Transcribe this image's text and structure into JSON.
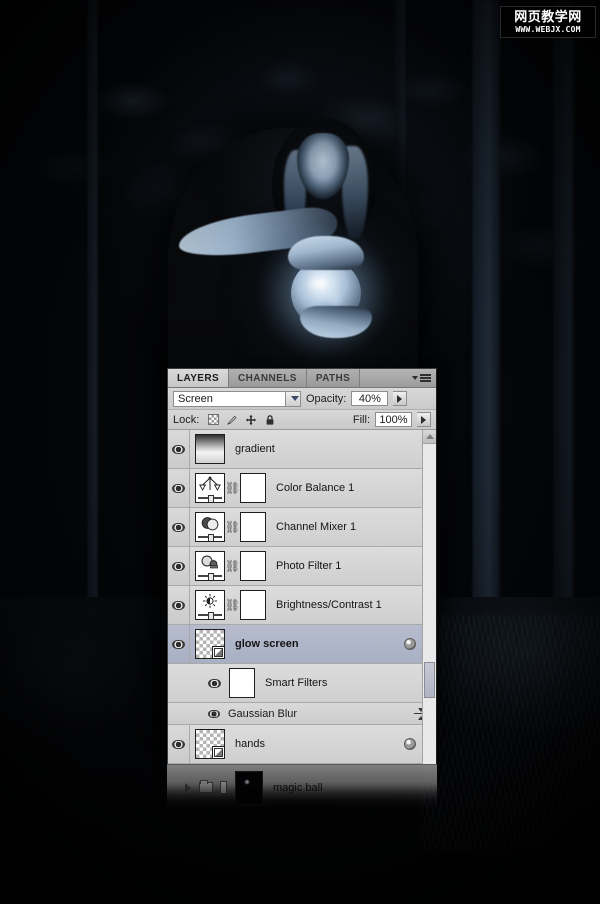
{
  "watermark": {
    "chinese": "网页教学网",
    "url": "WWW.WEBJX.COM"
  },
  "photo": {
    "description": "dark-forest-hooded-figure-with-glowing-magic-ball"
  },
  "panel": {
    "tabs": [
      {
        "label": "LAYERS",
        "active": true
      },
      {
        "label": "CHANNELS",
        "active": false
      },
      {
        "label": "PATHS",
        "active": false
      }
    ],
    "menu_icon": "panel-menu-icon",
    "blend": {
      "mode_value": "Screen",
      "opacity_label": "Opacity:",
      "opacity_value": "40%",
      "fill_label": "Fill:",
      "fill_value": "100%"
    },
    "lock": {
      "label": "Lock:",
      "items": [
        {
          "icon": "lock-transparent-pixels-icon"
        },
        {
          "icon": "lock-image-pixels-brush-icon"
        },
        {
          "icon": "lock-position-move-icon"
        },
        {
          "icon": "lock-all-padlock-icon"
        }
      ]
    },
    "layers": [
      {
        "name": "gradient",
        "visible": true,
        "selected": false,
        "thumb": "gradient-thumbnail",
        "kind": "pixel",
        "has_mask": false,
        "bold": false
      },
      {
        "name": "Color Balance 1",
        "visible": true,
        "selected": false,
        "thumb": "color-balance-adjustment-icon",
        "kind": "adjustment",
        "has_mask": true,
        "bold": false
      },
      {
        "name": "Channel Mixer 1",
        "visible": true,
        "selected": false,
        "thumb": "channel-mixer-adjustment-icon",
        "kind": "adjustment",
        "has_mask": true,
        "bold": false
      },
      {
        "name": "Photo Filter 1",
        "visible": true,
        "selected": false,
        "thumb": "photo-filter-adjustment-icon",
        "kind": "adjustment",
        "has_mask": true,
        "bold": false
      },
      {
        "name": "Brightness/Contrast 1",
        "visible": true,
        "selected": false,
        "thumb": "brightness-contrast-adjustment-icon",
        "kind": "adjustment",
        "has_mask": true,
        "bold": false
      },
      {
        "name": "glow screen",
        "visible": true,
        "selected": true,
        "thumb": "smart-object-thumbnail",
        "kind": "smart-object",
        "has_mask": false,
        "bold": true
      }
    ],
    "smart_filters": {
      "label": "Smart Filters",
      "visible": true,
      "filters": [
        {
          "name": "Gaussian Blur",
          "visible": true,
          "options_icon": "filter-blending-options-icon"
        }
      ]
    },
    "bottom_layer": {
      "name": "hands",
      "visible": true,
      "thumb": "smart-object-thumbnail",
      "kind": "smart-object"
    },
    "ghost_row": {
      "name": "magic ball",
      "expand_icon": "group-expand-triangle-icon",
      "folder_icon": "layer-group-folder-icon",
      "mask_icon": "group-mask-icon"
    },
    "scrollbar": {
      "up_arrow": "scroll-up-arrow-icon"
    }
  }
}
